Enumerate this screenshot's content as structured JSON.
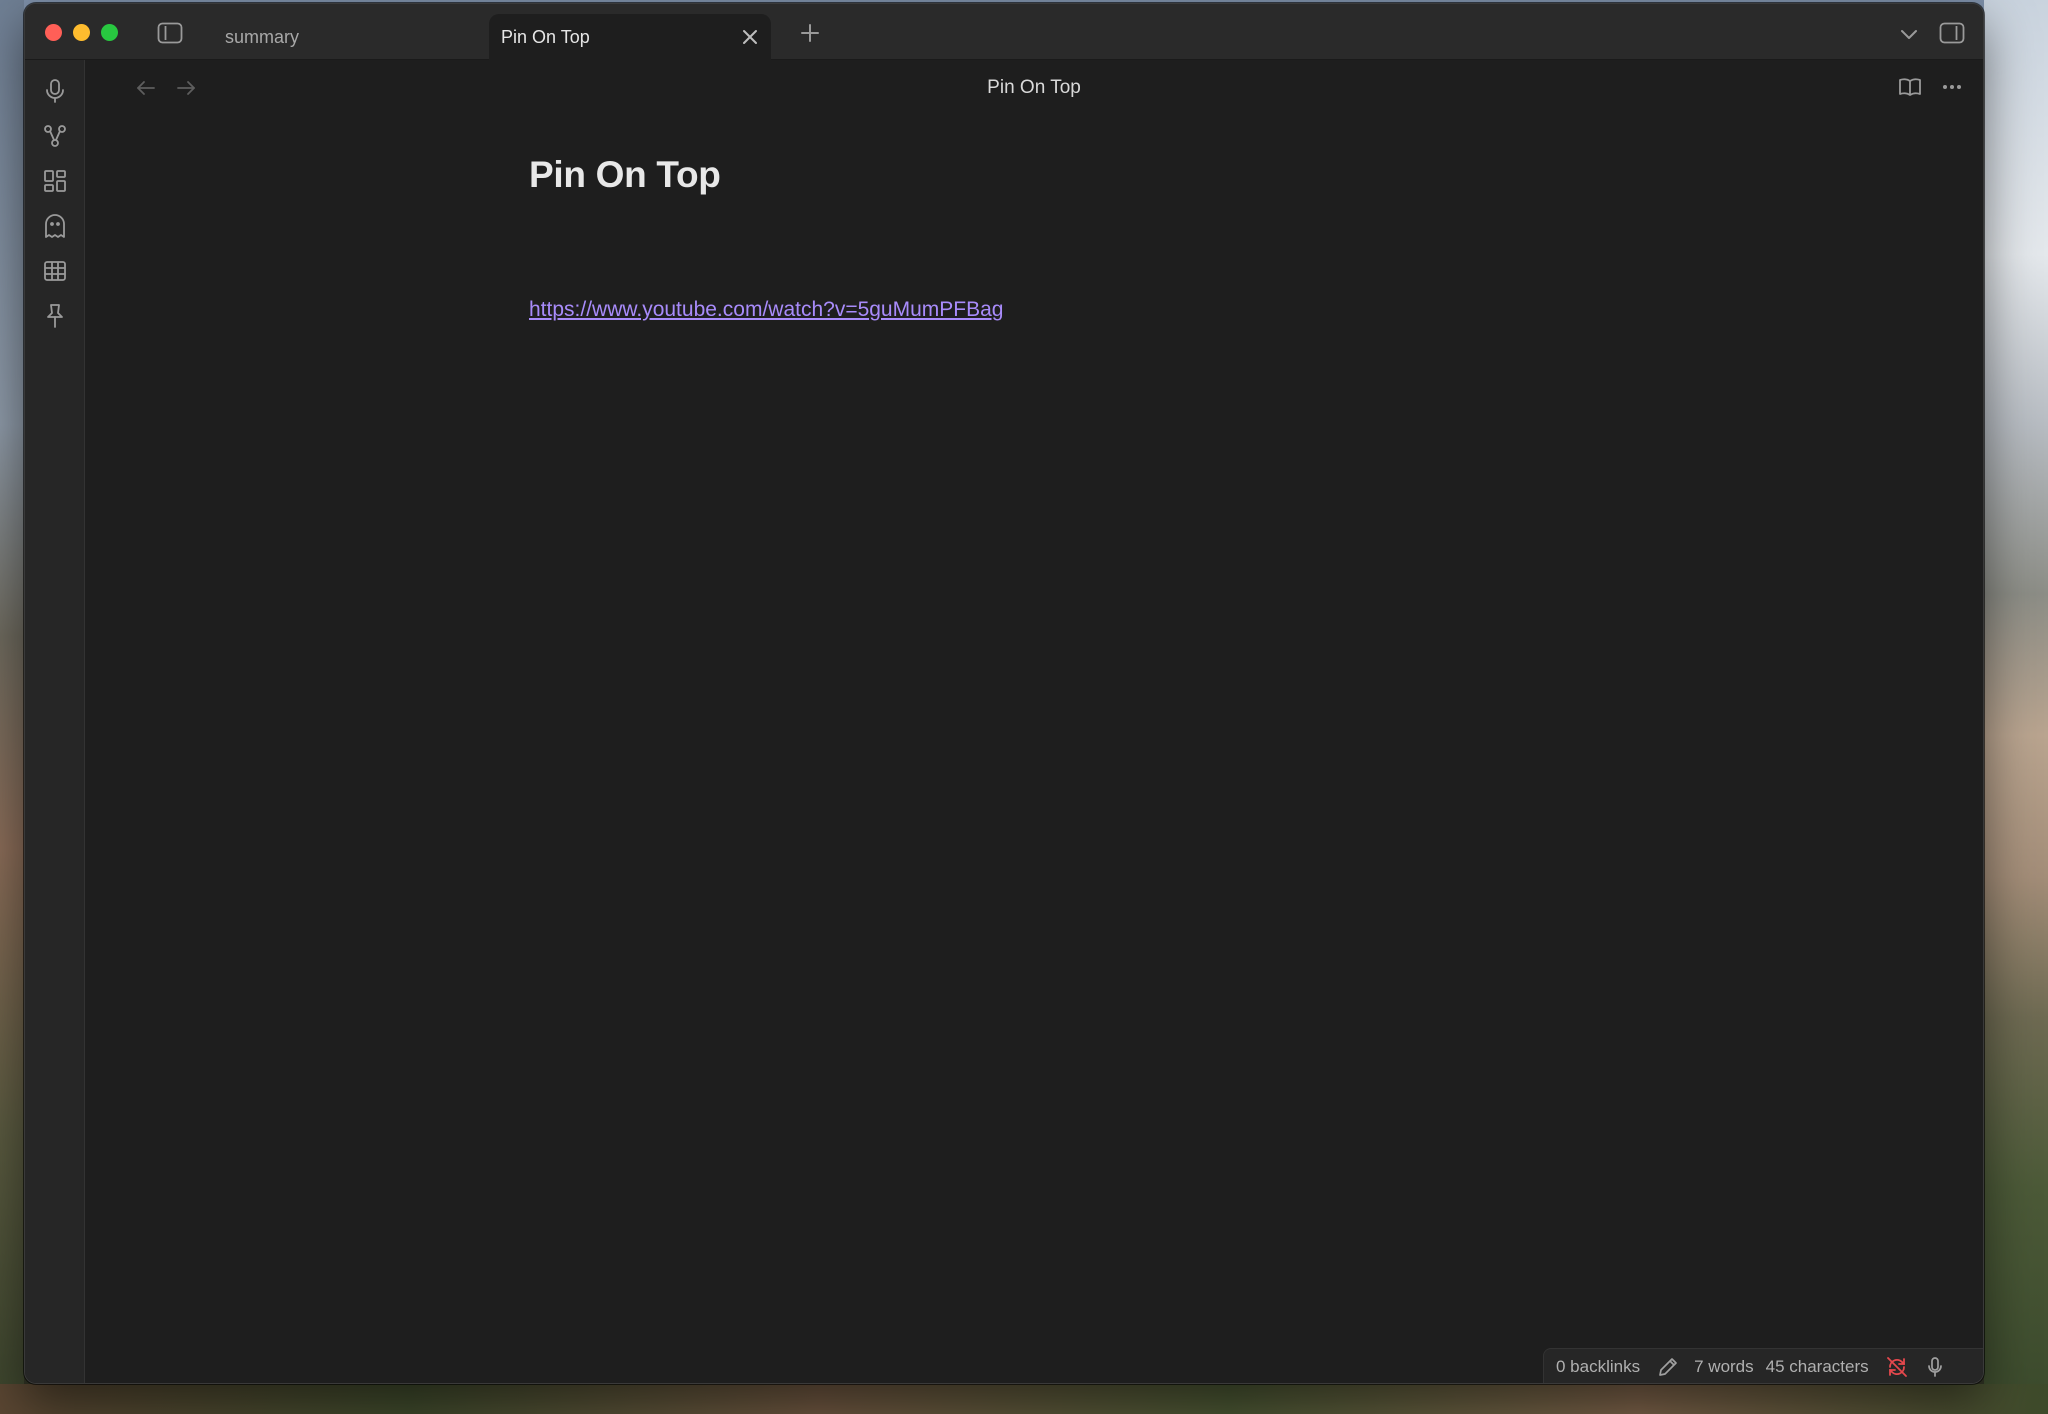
{
  "tabs": [
    {
      "label": "summary",
      "active": false
    },
    {
      "label": "Pin On Top",
      "active": true
    }
  ],
  "view": {
    "title": "Pin On Top"
  },
  "document": {
    "heading": "Pin On Top",
    "link": "https://www.youtube.com/watch?v=5guMumPFBag"
  },
  "ribbon": {
    "icons": [
      "microphone-icon",
      "graph-icon",
      "layout-grid-icon",
      "ghost-icon",
      "table-icon",
      "pin-icon"
    ]
  },
  "status": {
    "backlinks": "0 backlinks",
    "words": "7 words",
    "characters": "45 characters",
    "sync_color": "#e5484d"
  },
  "colors": {
    "link": "#a88bfa",
    "background": "#1e1e1e"
  }
}
